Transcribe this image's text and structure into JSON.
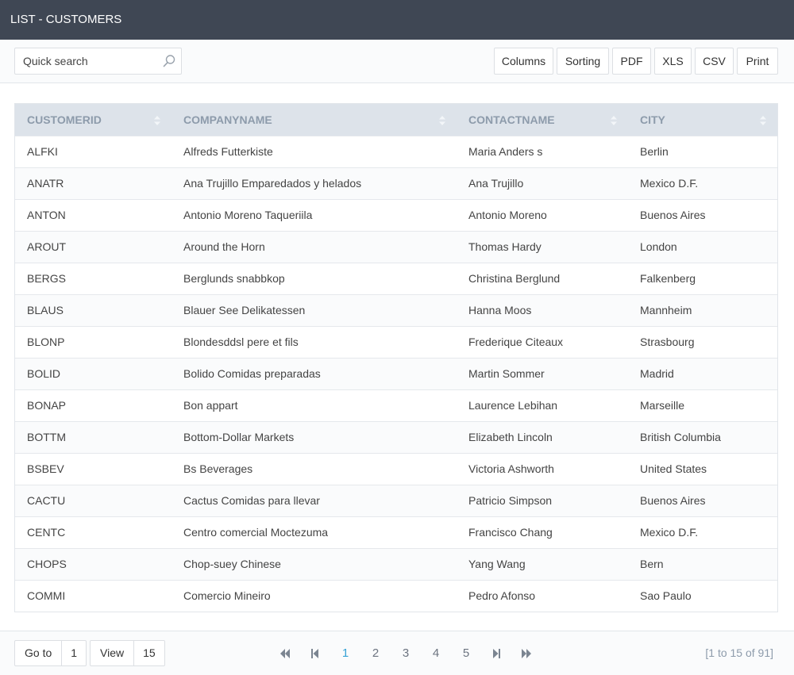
{
  "header": {
    "title": "LIST - CUSTOMERS"
  },
  "toolbar": {
    "search_placeholder": "Quick search",
    "buttons": {
      "columns": "Columns",
      "sorting": "Sorting",
      "pdf": "PDF",
      "xls": "XLS",
      "csv": "CSV",
      "print": "Print"
    }
  },
  "table": {
    "headers": [
      "CUSTOMERID",
      "COMPANYNAME",
      "CONTACTNAME",
      "CITY"
    ],
    "rows": [
      [
        "ALFKI",
        "Alfreds Futterkiste",
        "Maria Anders s",
        "Berlin"
      ],
      [
        "ANATR",
        "Ana Trujillo Emparedados y helados",
        "Ana Trujillo",
        "Mexico D.F."
      ],
      [
        "ANTON",
        "Antonio Moreno Taqueriila",
        "Antonio Moreno",
        "Buenos Aires"
      ],
      [
        "AROUT",
        "Around the Horn",
        "Thomas Hardy",
        "London"
      ],
      [
        "BERGS",
        "Berglunds snabbkop",
        "Christina Berglund",
        "Falkenberg"
      ],
      [
        "BLAUS",
        "Blauer See Delikatessen",
        "Hanna Moos",
        "Mannheim"
      ],
      [
        "BLONP",
        "Blondesddsl pere et fils",
        "Frederique Citeaux",
        "Strasbourg"
      ],
      [
        "BOLID",
        "Bolido Comidas preparadas",
        "Martin Sommer",
        "Madrid"
      ],
      [
        "BONAP",
        "Bon appart",
        "Laurence Lebihan",
        "Marseille"
      ],
      [
        "BOTTM",
        "Bottom-Dollar Markets",
        "Elizabeth Lincoln",
        "British Columbia"
      ],
      [
        "BSBEV",
        "Bs Beverages",
        "Victoria Ashworth",
        "United States"
      ],
      [
        "CACTU",
        "Cactus Comidas para llevar",
        "Patricio Simpson",
        "Buenos Aires"
      ],
      [
        "CENTC",
        "Centro comercial Moctezuma",
        "Francisco Chang",
        "Mexico D.F."
      ],
      [
        "CHOPS",
        "Chop-suey Chinese",
        "Yang Wang",
        "Bern"
      ],
      [
        "COMMI",
        "Comercio Mineiro",
        "Pedro Afonso",
        "Sao Paulo"
      ]
    ]
  },
  "footer": {
    "goto_label": "Go to",
    "goto_value": "1",
    "view_label": "View",
    "view_value": "15",
    "pages": [
      "1",
      "2",
      "3",
      "4",
      "5"
    ],
    "active_page": "1",
    "summary": "[1 to 15 of 91]"
  },
  "colors": {
    "header_bg": "#3f4754",
    "table_header_bg": "#dde3ea",
    "active_page": "#36a2d6"
  }
}
